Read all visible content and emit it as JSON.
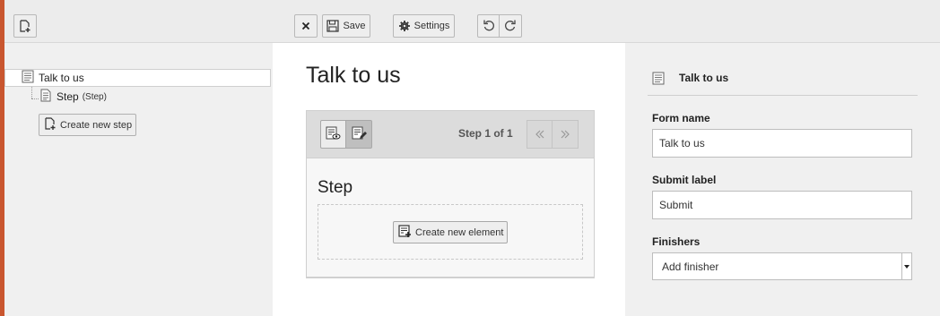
{
  "toolbar": {
    "new_form_label": "",
    "close_label": "",
    "save_label": "Save",
    "settings_label": "Settings",
    "undo_label": "",
    "redo_label": ""
  },
  "tree": {
    "root_label": "Talk to us",
    "step_label": "Step",
    "step_type": "(Step)",
    "create_step_label": "Create new step"
  },
  "stage": {
    "title": "Talk to us",
    "step_count": "Step 1 of 1",
    "step_heading": "Step",
    "create_element_label": "Create new element"
  },
  "inspector": {
    "header_title": "Talk to us",
    "form_name_label": "Form name",
    "form_name_value": "Talk to us",
    "submit_label_label": "Submit label",
    "submit_label_value": "Submit",
    "finishers_label": "Finishers",
    "finishers_value": "Add finisher"
  },
  "colors": {
    "accent": "#c9562f",
    "stage_background": "#ffffff",
    "panel_background": "#f0f0f0"
  },
  "icons": {
    "new_form": "document-plus-icon",
    "close": "close-icon",
    "save": "floppy-disk-icon",
    "settings": "gear-icon",
    "undo": "undo-icon",
    "redo": "redo-icon",
    "form": "form-page-icon",
    "step": "page-icon",
    "preview": "preview-eye-icon",
    "edit": "edit-form-icon",
    "first_page": "double-chevron-left-icon",
    "last_page": "double-chevron-right-icon"
  }
}
